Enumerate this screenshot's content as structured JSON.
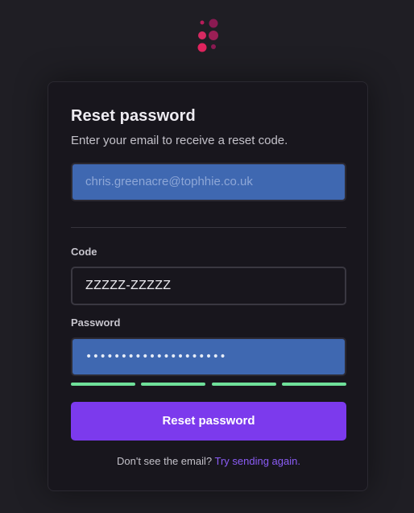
{
  "logo": {
    "icon": "dots-logo-icon",
    "colors": [
      "#e0245e",
      "#b81d5a",
      "#8a1a52"
    ]
  },
  "form": {
    "title": "Reset password",
    "subtitle": "Enter your email to receive a reset code.",
    "email": {
      "placeholder": "chris.greenacre@tophhie.co.uk"
    },
    "code": {
      "label": "Code",
      "value": "ZZZZZ-ZZZZZ"
    },
    "password": {
      "label": "Password",
      "value": "••••••••••••••••••••"
    },
    "strength": {
      "segments_filled": 4,
      "segments_total": 4,
      "color": "#6fe09a"
    },
    "submit_label": "Reset password",
    "footer": {
      "prompt": "Don't see the email?",
      "link": "Try sending again."
    }
  },
  "colors": {
    "accent": "#7c3aed",
    "link": "#8b5cf6",
    "autofill_bg": "#3f68b1"
  }
}
